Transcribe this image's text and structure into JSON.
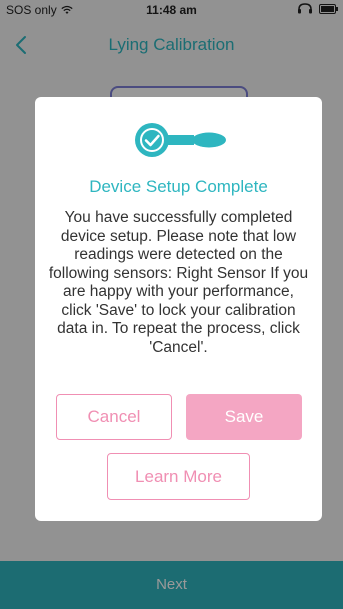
{
  "status_bar": {
    "carrier": "SOS only",
    "time": "11:48 am"
  },
  "nav": {
    "title": "Lying Calibration"
  },
  "modal": {
    "title": "Device Setup Complete",
    "message": "You have successfully completed device setup. Please note that low readings were detected on the following sensors: Right Sensor  If you are happy with your performance, click 'Save' to lock your calibration data in. To repeat the process, click 'Cancel'.",
    "cancel_label": "Cancel",
    "save_label": "Save",
    "learn_more_label": "Learn More"
  },
  "bottom_bar": {
    "next_label": "Next"
  },
  "colors": {
    "accent_teal": "#2eb6c0",
    "accent_pink": "#f08fb3",
    "save_pink": "#f4a6c3"
  },
  "icons": {
    "wifi": "wifi-icon",
    "headphones": "headphones-icon",
    "battery": "battery-icon",
    "back": "chevron-left-icon",
    "device": "device-check-icon"
  }
}
